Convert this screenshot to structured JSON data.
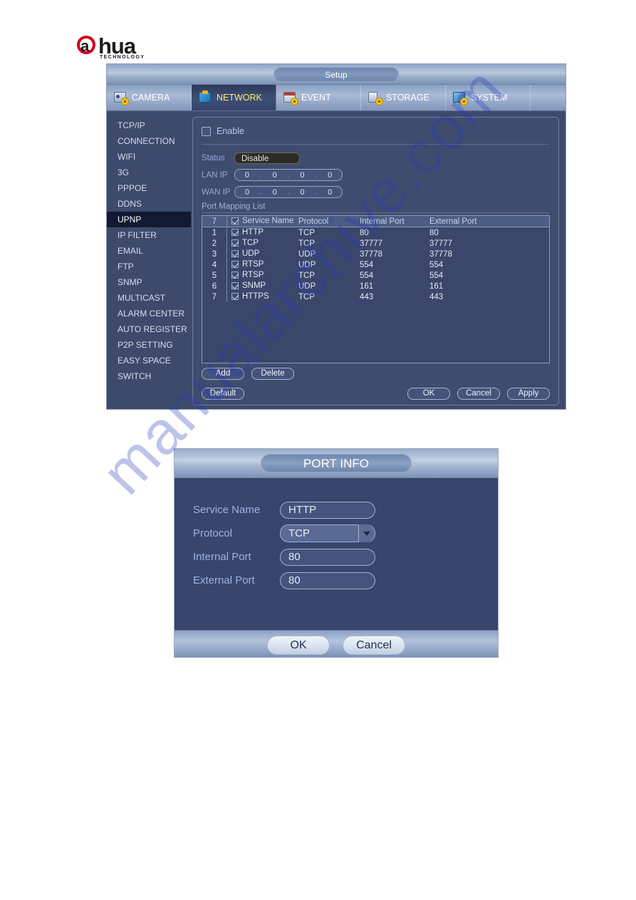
{
  "brand": {
    "name": "alhua",
    "name_display": "hua",
    "tagline": "TECHNOLOGY"
  },
  "window": {
    "title": "Setup",
    "tabs": [
      {
        "label": "CAMERA",
        "icon": "camera-icon",
        "active": false
      },
      {
        "label": "NETWORK",
        "icon": "network-icon",
        "active": true
      },
      {
        "label": "EVENT",
        "icon": "event-icon",
        "active": false
      },
      {
        "label": "STORAGE",
        "icon": "storage-icon",
        "active": false
      },
      {
        "label": "SYSTEM",
        "icon": "system-icon",
        "active": false
      }
    ]
  },
  "sidebar": {
    "items": [
      {
        "label": "TCP/IP",
        "active": false
      },
      {
        "label": "CONNECTION",
        "active": false
      },
      {
        "label": "WIFI",
        "active": false
      },
      {
        "label": "3G",
        "active": false
      },
      {
        "label": "PPPOE",
        "active": false
      },
      {
        "label": "DDNS",
        "active": false
      },
      {
        "label": "UPNP",
        "active": true
      },
      {
        "label": "IP FILTER",
        "active": false
      },
      {
        "label": "EMAIL",
        "active": false
      },
      {
        "label": "FTP",
        "active": false
      },
      {
        "label": "SNMP",
        "active": false
      },
      {
        "label": "MULTICAST",
        "active": false
      },
      {
        "label": "ALARM CENTER",
        "active": false
      },
      {
        "label": "AUTO REGISTER",
        "active": false
      },
      {
        "label": "P2P SETTING",
        "active": false
      },
      {
        "label": "EASY SPACE",
        "active": false
      },
      {
        "label": "SWITCH",
        "active": false
      }
    ]
  },
  "upnp": {
    "enable_label": "Enable",
    "enable_checked": false,
    "status_label": "Status",
    "status_value": "Disable",
    "lan_ip_label": "LAN IP",
    "lan_ip": [
      "0",
      "0",
      "0",
      "0"
    ],
    "wan_ip_label": "WAN IP",
    "wan_ip": [
      "0",
      "0",
      "0",
      "0"
    ],
    "port_mapping_label": "Port Mapping List",
    "table": {
      "header": {
        "index": "7",
        "service_name": "Service Name",
        "protocol": "Protocol",
        "internal_port": "Internal Port",
        "external_port": "External Port",
        "checked": true
      },
      "rows": [
        {
          "index": "1",
          "checked": true,
          "service_name": "HTTP",
          "protocol": "TCP",
          "internal_port": "80",
          "external_port": "80"
        },
        {
          "index": "2",
          "checked": true,
          "service_name": "TCP",
          "protocol": "TCP",
          "internal_port": "37777",
          "external_port": "37777"
        },
        {
          "index": "3",
          "checked": true,
          "service_name": "UDP",
          "protocol": "UDP",
          "internal_port": "37778",
          "external_port": "37778"
        },
        {
          "index": "4",
          "checked": true,
          "service_name": "RTSP",
          "protocol": "UDP",
          "internal_port": "554",
          "external_port": "554"
        },
        {
          "index": "5",
          "checked": true,
          "service_name": "RTSP",
          "protocol": "TCP",
          "internal_port": "554",
          "external_port": "554"
        },
        {
          "index": "6",
          "checked": true,
          "service_name": "SNMP",
          "protocol": "UDP",
          "internal_port": "161",
          "external_port": "161"
        },
        {
          "index": "7",
          "checked": true,
          "service_name": "HTTPS",
          "protocol": "TCP",
          "internal_port": "443",
          "external_port": "443"
        }
      ]
    },
    "buttons": {
      "add": "Add",
      "delete": "Delete",
      "default": "Default",
      "ok": "OK",
      "cancel": "Cancel",
      "apply": "Apply"
    }
  },
  "dialog": {
    "title": "PORT INFO",
    "fields": {
      "service_name_label": "Service Name",
      "service_name_value": "HTTP",
      "protocol_label": "Protocol",
      "protocol_value": "TCP",
      "internal_port_label": "Internal Port",
      "internal_port_value": "80",
      "external_port_label": "External Port",
      "external_port_value": "80"
    },
    "buttons": {
      "ok": "OK",
      "cancel": "Cancel"
    }
  },
  "watermark": {
    "text": "manualarchive.com"
  },
  "colors": {
    "window_bg": "#3d4a6b",
    "accent_yellow": "#ffe97a",
    "label_blue": "#9fb4e0",
    "titlebar": "#b9c8de",
    "active_item_bg": "#121a33"
  }
}
